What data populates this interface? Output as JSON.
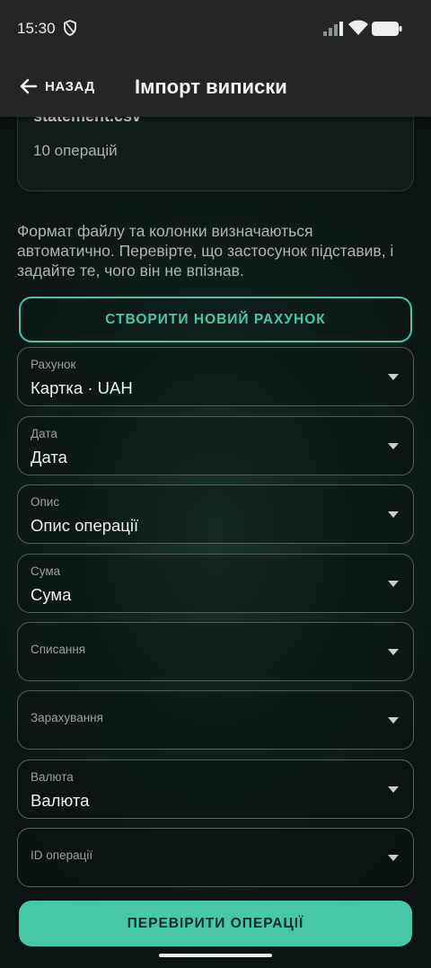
{
  "status_bar": {
    "time": "15:30"
  },
  "app_bar": {
    "back_label": "НАЗАД",
    "title": "Імпорт виписки"
  },
  "file_card": {
    "file_name": "statement.csv",
    "operations_count": "10 операцій"
  },
  "info_text": "Формат файлу та колонки визначаються автоматично. Перевірте, що застосунок підставив, і задайте те, чого він не впізнав.",
  "create_account_label": "СТВОРИТИ НОВИЙ РАХУНОК",
  "fields": [
    {
      "label": "Рахунок",
      "value": "Картка · UAH"
    },
    {
      "label": "Дата",
      "value": "Дата"
    },
    {
      "label": "Опис",
      "value": "Опис операції"
    },
    {
      "label": "Сума",
      "value": "Сума"
    },
    {
      "label": "Списання",
      "value": ""
    },
    {
      "label": "Зарахування",
      "value": ""
    },
    {
      "label": "Валюта",
      "value": "Валюта"
    },
    {
      "label": "ID операції",
      "value": ""
    }
  ],
  "verify_label": "ПЕРЕВІРИТИ ОПЕРАЦІЇ",
  "colors": {
    "accent": "#46c8a6",
    "background": "#0f1f1b",
    "bar": "#232624"
  }
}
